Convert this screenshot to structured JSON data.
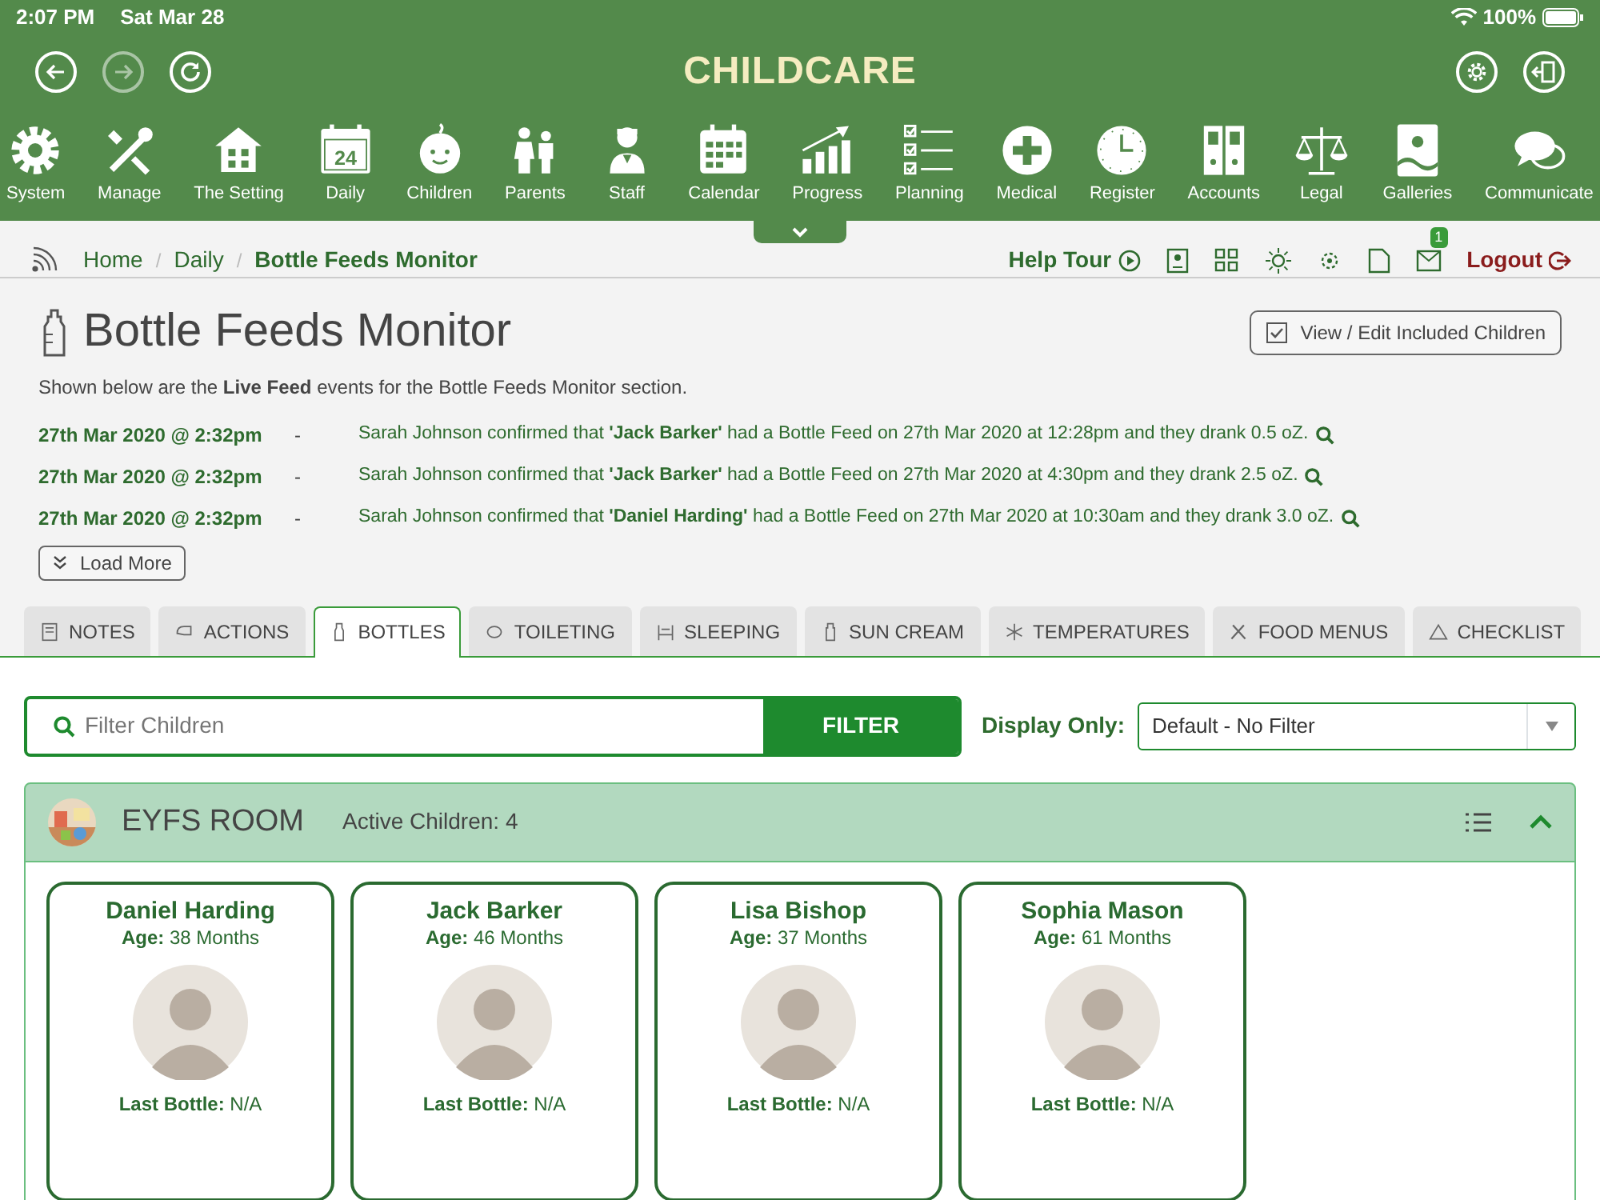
{
  "status_bar": {
    "time": "2:07 PM",
    "date": "Sat Mar 28",
    "battery": "100%"
  },
  "header": {
    "title": "CHILDCARE"
  },
  "nav": [
    {
      "label": "System",
      "kind": "gear"
    },
    {
      "label": "Manage",
      "kind": "tools"
    },
    {
      "label": "The Setting",
      "kind": "house"
    },
    {
      "label": "Daily",
      "kind": "daycal"
    },
    {
      "label": "Children",
      "kind": "baby"
    },
    {
      "label": "Parents",
      "kind": "people"
    },
    {
      "label": "Staff",
      "kind": "person"
    },
    {
      "label": "Calendar",
      "kind": "calendar"
    },
    {
      "label": "Progress",
      "kind": "chart"
    },
    {
      "label": "Planning",
      "kind": "checklist"
    },
    {
      "label": "Medical",
      "kind": "plus"
    },
    {
      "label": "Register",
      "kind": "clock"
    },
    {
      "label": "Accounts",
      "kind": "binders"
    },
    {
      "label": "Legal",
      "kind": "scales"
    },
    {
      "label": "Galleries"
    },
    {
      "label": "Communicate",
      "kind": "chat"
    }
  ],
  "nav_day": "24",
  "breadcrumb": [
    {
      "label": "Home",
      "current": false
    },
    {
      "label": "Daily",
      "current": false
    },
    {
      "label": "Bottle Feeds Monitor",
      "current": true
    }
  ],
  "breadcrumb_separators": [
    "/",
    "/"
  ],
  "toolbar": {
    "help_tour": "Help Tour",
    "message_count": "1",
    "logout": "Logout"
  },
  "page": {
    "title": "Bottle Feeds Monitor",
    "edit_button": "View / Edit Included Children",
    "intro": "Shown below are the **Live Feed** events for the Bottle Feeds Monitor section."
  },
  "events": [
    {
      "time": "27th Mar 2020 @ 2:32pm",
      "separator": "-",
      "text": "Sarah Johnson confirmed that **'Jack Barker'** had a Bottle Feed on 27th Mar 2020 at 12:28pm and they drank 0.5 oZ."
    },
    {
      "time": "27th Mar 2020 @ 2:32pm",
      "separator": "-",
      "text": "Sarah Johnson confirmed that **'Jack Barker'** had a Bottle Feed on 27th Mar 2020 at 4:30pm and they drank 2.5 oZ."
    },
    {
      "time": "27th Mar 2020 @ 2:32pm",
      "separator": "-",
      "text": "Sarah Johnson confirmed that **'Daniel Harding'** had a Bottle Feed on 27th Mar 2020 at 10:30am and they drank 3.0 oZ."
    }
  ],
  "load_more": "Load More",
  "tabs": [
    {
      "label": "NOTES",
      "selected": false
    },
    {
      "label": "ACTIONS",
      "selected": false
    },
    {
      "label": "BOTTLES",
      "selected": true
    },
    {
      "label": "TOILETING",
      "selected": false
    },
    {
      "label": "SLEEPING",
      "selected": false
    },
    {
      "label": "SUN CREAM",
      "selected": false
    },
    {
      "label": "TEMPERATURES",
      "selected": false
    },
    {
      "label": "FOOD MENUS",
      "selected": false
    },
    {
      "label": "CHECKLIST",
      "selected": false
    }
  ],
  "filter": {
    "placeholder": "Filter Children",
    "button": "FILTER",
    "display_label": "Display Only:",
    "display_value": "Default - No Filter"
  },
  "room": {
    "name": "EYFS ROOM",
    "active_children": "Active Children: 4",
    "expanded": true
  },
  "children": [
    {
      "name": "Daniel Harding",
      "age": "**Age:** 38 Months",
      "last_bottle": "**Last Bottle:** N/A"
    },
    {
      "name": "Jack Barker",
      "age": "**Age:** 46 Months",
      "last_bottle": "**Last Bottle:** N/A"
    },
    {
      "name": "Lisa Bishop",
      "age": "**Age:** 37 Months",
      "last_bottle": "**Last Bottle:** N/A"
    },
    {
      "name": "Sophia Mason",
      "age": "**Age:** 61 Months",
      "last_bottle": "**Last Bottle:** N/A"
    }
  ]
}
